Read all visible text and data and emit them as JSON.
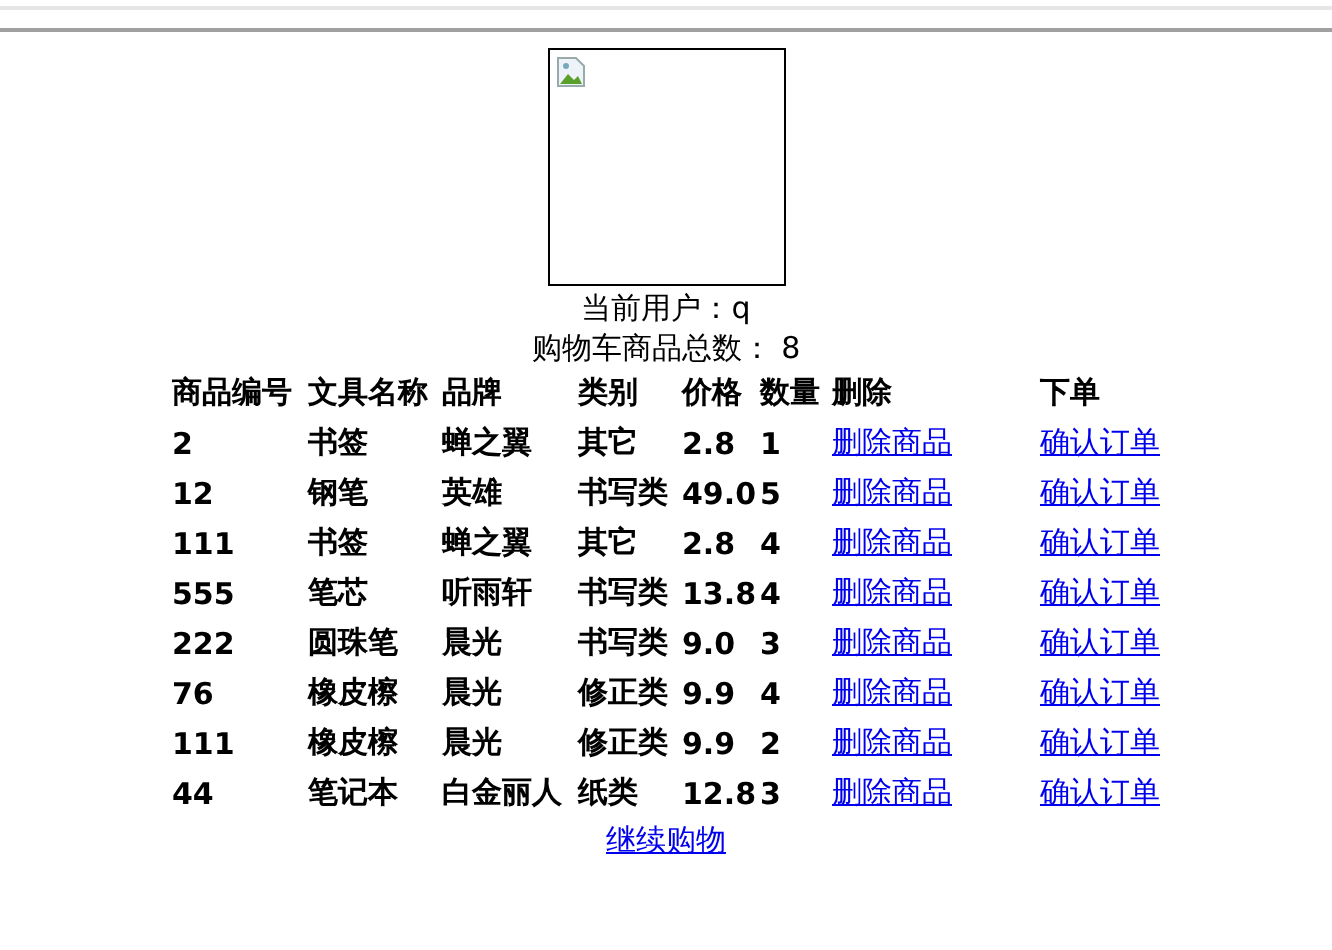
{
  "user_line": "当前用户：q",
  "cart_count_line": "购物车商品总数： 8",
  "table": {
    "columns": [
      "商品编号",
      "文具名称",
      "品牌",
      "类别",
      "价格",
      "数量",
      "删除",
      "下单"
    ],
    "rows": [
      {
        "id": "2",
        "name": "书签",
        "brand": "蝉之翼",
        "category": "其它",
        "price": "2.8",
        "qty": "1",
        "delete_link": "删除商品",
        "order_link": "确认订单"
      },
      {
        "id": "12",
        "name": "钢笔",
        "brand": "英雄",
        "category": "书写类",
        "price": "49.0",
        "qty": "5",
        "delete_link": "删除商品",
        "order_link": "确认订单"
      },
      {
        "id": "111",
        "name": "书签",
        "brand": "蝉之翼",
        "category": "其它",
        "price": "2.8",
        "qty": "4",
        "delete_link": "删除商品",
        "order_link": "确认订单"
      },
      {
        "id": "555",
        "name": "笔芯",
        "brand": "听雨轩",
        "category": "书写类",
        "price": "13.8",
        "qty": "4",
        "delete_link": "删除商品",
        "order_link": "确认订单"
      },
      {
        "id": "222",
        "name": "圆珠笔",
        "brand": "晨光",
        "category": "书写类",
        "price": "9.0",
        "qty": "3",
        "delete_link": "删除商品",
        "order_link": "确认订单"
      },
      {
        "id": "76",
        "name": "橡皮檫",
        "brand": "晨光",
        "category": "修正类",
        "price": "9.9",
        "qty": "4",
        "delete_link": "删除商品",
        "order_link": "确认订单"
      },
      {
        "id": "111",
        "name": "橡皮檫",
        "brand": "晨光",
        "category": "修正类",
        "price": "9.9",
        "qty": "2",
        "delete_link": "删除商品",
        "order_link": "确认订单"
      },
      {
        "id": "44",
        "name": "笔记本",
        "brand": "白金丽人",
        "category": "纸类",
        "price": "12.8",
        "qty": "3",
        "delete_link": "删除商品",
        "order_link": "确认订单"
      }
    ]
  },
  "continue_link": "继续购物"
}
